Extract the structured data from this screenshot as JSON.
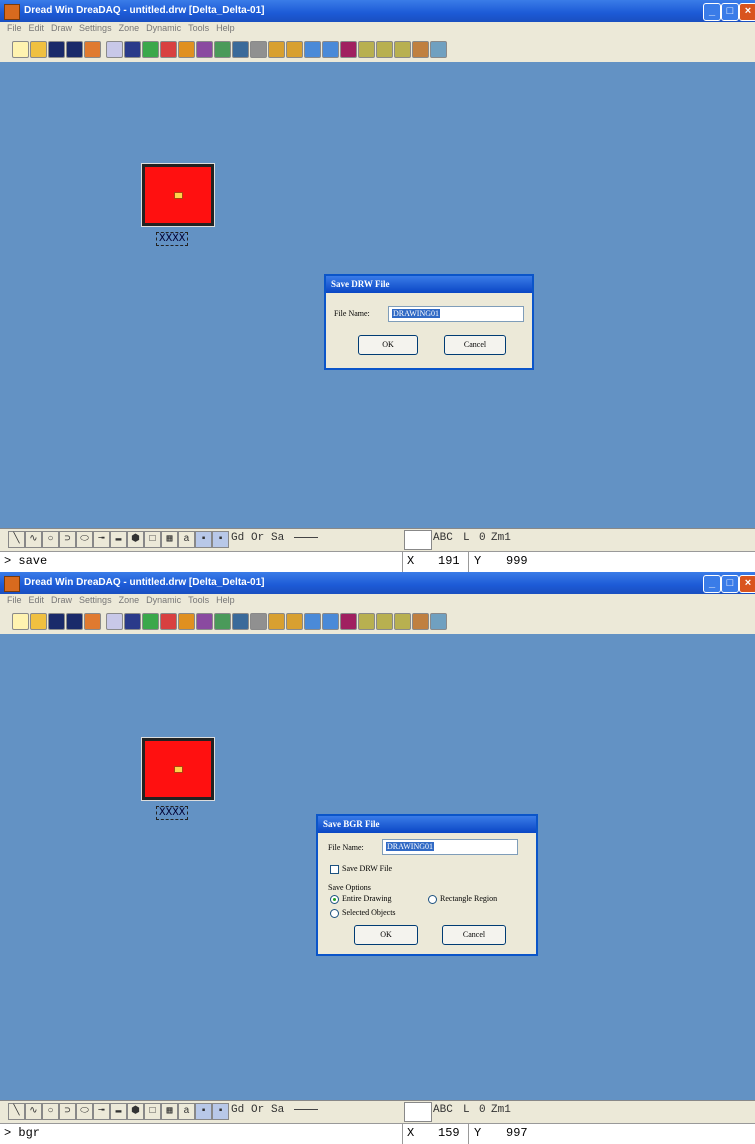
{
  "colors": {
    "desktop": "#6392c4",
    "titlebar": "#1c5ad6",
    "object_fill": "#ff1010"
  },
  "panel1": {
    "title": "Dread Win DreaDAQ - untitled.drw [Delta_Delta-01]",
    "menu": [
      "File",
      "Edit",
      "Draw",
      "Settings",
      "Zone",
      "Dynamic",
      "Tools",
      "Help"
    ],
    "object_label": "XXXX",
    "dialog": {
      "title": "Save DRW File",
      "file_name_label": "File Name:",
      "file_name_value": "DRAWING01",
      "ok": "OK",
      "cancel": "Cancel"
    },
    "bottom_tools": [
      "Gd",
      "Or",
      "Sa",
      "ABC",
      "L",
      "0",
      "Zm1"
    ],
    "command": "> save",
    "x_label": "X",
    "x_value": "191",
    "y_label": "Y",
    "y_value": "999"
  },
  "panel2": {
    "title": "Dread Win DreaDAQ - untitled.drw [Delta_Delta-01]",
    "menu": [
      "File",
      "Edit",
      "Draw",
      "Settings",
      "Zone",
      "Dynamic",
      "Tools",
      "Help"
    ],
    "object_label": "XXXX",
    "dialog": {
      "title": "Save BGR File",
      "file_name_label": "File Name:",
      "file_name_value": "DRAWING01",
      "save_drw_label": "Save DRW File",
      "save_options_label": "Save Options",
      "entire_drawing": "Entire Drawing",
      "rectangle_region": "Rectangle Region",
      "selected_objects": "Selected Objects",
      "ok": "OK",
      "cancel": "Cancel"
    },
    "bottom_tools": [
      "Gd",
      "Or",
      "Sa",
      "ABC",
      "L",
      "0",
      "Zm1"
    ],
    "command": "> bgr",
    "x_label": "X",
    "x_value": "159",
    "y_label": "Y",
    "y_value": "997"
  }
}
